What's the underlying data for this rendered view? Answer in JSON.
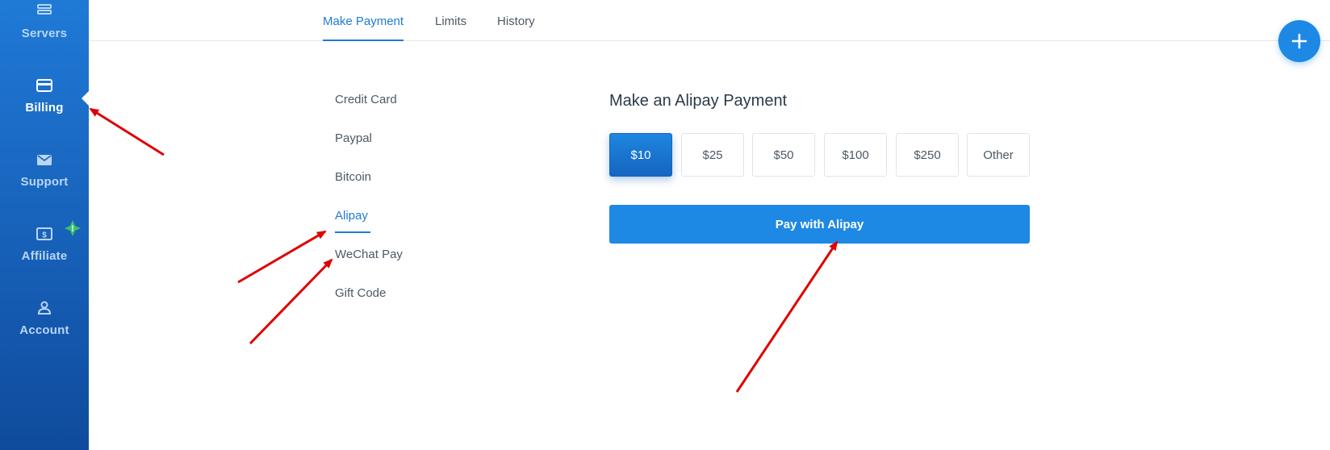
{
  "sidebar": {
    "items": [
      {
        "label": "Servers",
        "icon": "servers-icon"
      },
      {
        "label": "Billing",
        "icon": "credit-card-icon",
        "active": true
      },
      {
        "label": "Support",
        "icon": "envelope-icon"
      },
      {
        "label": "Affiliate",
        "icon": "dollar-bill-icon",
        "badge": "!"
      },
      {
        "label": "Account",
        "icon": "user-icon"
      }
    ]
  },
  "tabs": [
    {
      "label": "Make Payment",
      "active": true
    },
    {
      "label": "Limits"
    },
    {
      "label": "History"
    }
  ],
  "add_button": {
    "icon": "plus-icon"
  },
  "methods": [
    {
      "label": "Credit Card"
    },
    {
      "label": "Paypal"
    },
    {
      "label": "Bitcoin"
    },
    {
      "label": "Alipay",
      "active": true
    },
    {
      "label": "WeChat Pay"
    },
    {
      "label": "Gift Code"
    }
  ],
  "panel": {
    "title": "Make an Alipay Payment",
    "amounts": [
      "$10",
      "$25",
      "$50",
      "$100",
      "$250",
      "Other"
    ],
    "selected_amount": "$10",
    "pay_button": "Pay with Alipay"
  },
  "colors": {
    "accent": "#1e88e5",
    "sidebar": "#1760b8",
    "annotation": "#e00000",
    "badge": "#3cc46a"
  }
}
